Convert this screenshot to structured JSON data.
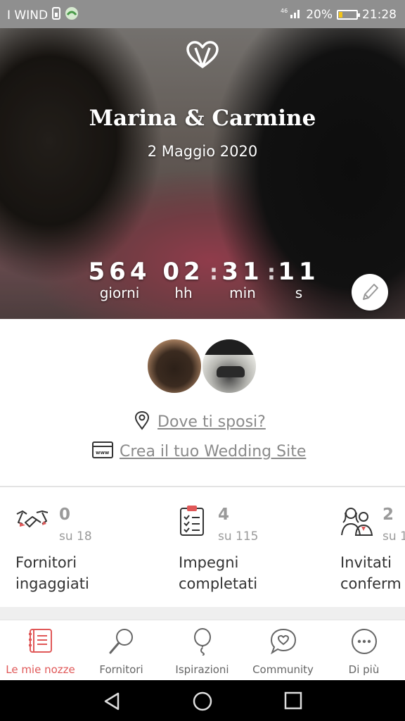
{
  "status_bar": {
    "carrier": "I WIND",
    "battery": "20%",
    "battery_level": 0.2,
    "time": "21:28"
  },
  "hero": {
    "couple_names": "Marina & Carmine",
    "wedding_date": "2 Maggio 2020",
    "countdown": [
      {
        "value": "564",
        "label": "giorni"
      },
      {
        "value": "02",
        "label": "hh"
      },
      {
        "value": "31",
        "label": "min"
      },
      {
        "value": "11",
        "label": "s"
      }
    ]
  },
  "links": {
    "location": "Dove ti sposi?",
    "wedding_site": "Crea il tuo Wedding Site"
  },
  "stats": [
    {
      "icon": "handshake-icon",
      "count": "0",
      "total": "su 18",
      "title_line1": "Fornitori",
      "title_line2": "ingaggiati"
    },
    {
      "icon": "checklist-icon",
      "count": "4",
      "total": "su 115",
      "title_line1": "Impegni",
      "title_line2": "completati"
    },
    {
      "icon": "guests-icon",
      "count": "2",
      "total": "su 1",
      "title_line1": "Invitati",
      "title_line2": "conferm"
    }
  ],
  "bottom_nav": [
    {
      "label": "Le mie nozze",
      "icon": "planner-book-icon",
      "active": true
    },
    {
      "label": "Fornitori",
      "icon": "search-icon",
      "active": false
    },
    {
      "label": "Ispirazioni",
      "icon": "balloon-icon",
      "active": false
    },
    {
      "label": "Community",
      "icon": "chat-heart-icon",
      "active": false
    },
    {
      "label": "Di più",
      "icon": "more-icon",
      "active": false
    }
  ],
  "colors": {
    "accent": "#e05858",
    "text": "#333333",
    "muted": "#9a9a9a"
  }
}
